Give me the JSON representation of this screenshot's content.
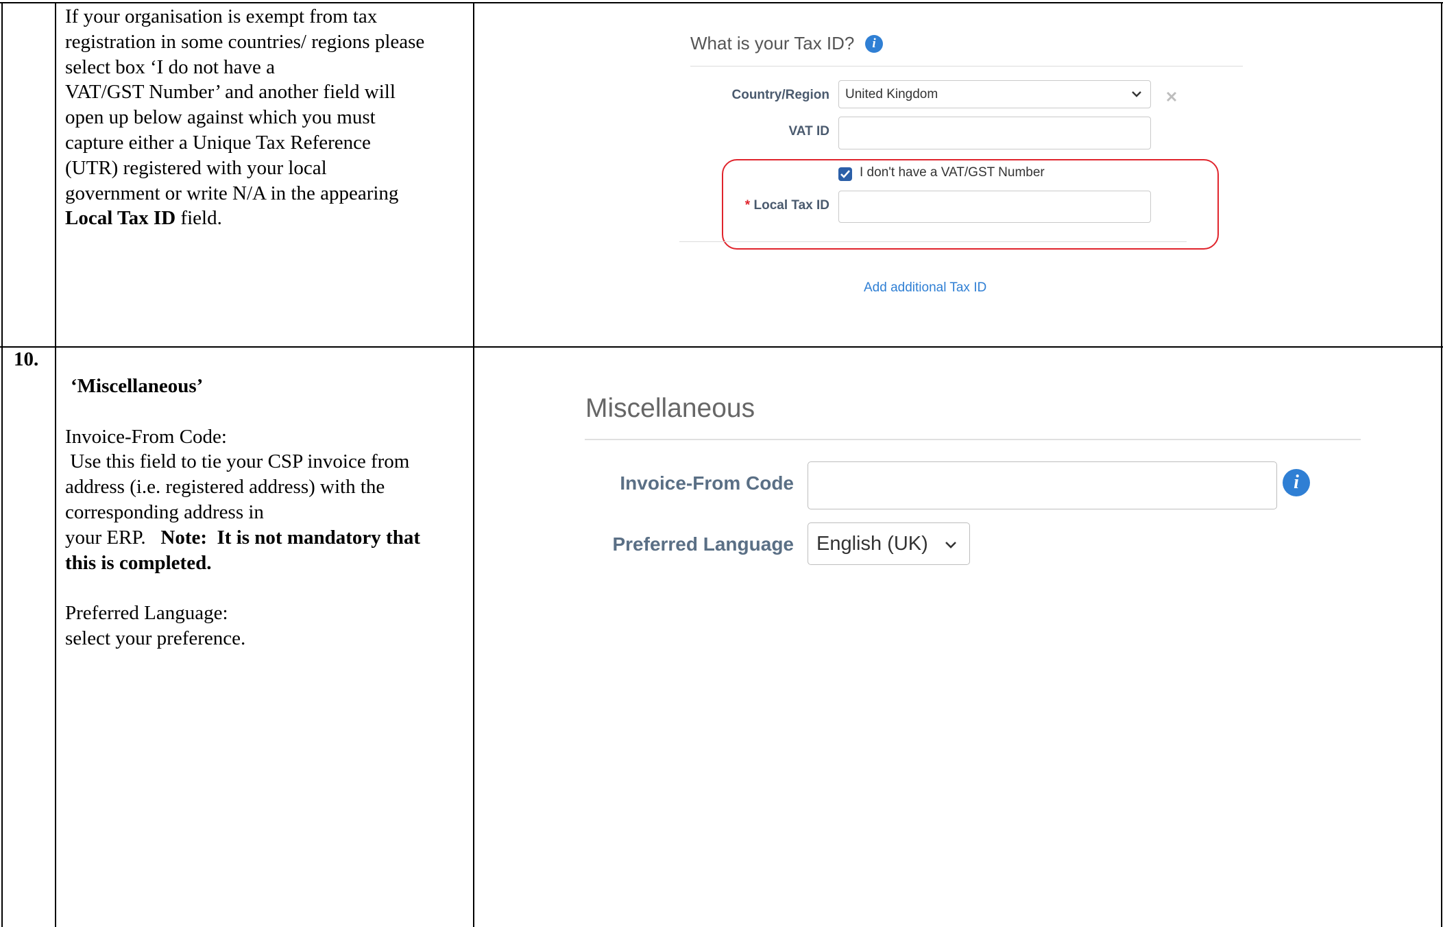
{
  "row_prev": {
    "description_lines": [
      "If your organisation is exempt from tax",
      "registration in some countries/ regions please",
      "select box ‘I do not have a",
      "VAT/GST Number’ and another field will",
      "open up below against which you must",
      "capture either a Unique Tax Reference",
      "(UTR) registered with your local",
      "government or write N/A in the appearing"
    ],
    "last_line_bold": "Local Tax ID",
    "last_line_rest": " field."
  },
  "tax_panel": {
    "title": "What is your Tax ID?",
    "country_label": "Country/Region",
    "country_value": "United Kingdom",
    "vat_label": "VAT ID",
    "vat_value": "",
    "checkbox_label": "I don't have a VAT/GST Number",
    "checkbox_checked": true,
    "required_mark": "*",
    "local_tax_label": "Local Tax ID",
    "local_tax_value": "",
    "add_link": "Add additional Tax ID",
    "highlight_color": "#e0242c",
    "accent_color": "#2f7fd4"
  },
  "row_10": {
    "number": "10.",
    "heading": "‘Miscellaneous’",
    "invoice_heading": "Invoice-From Code:",
    "invoice_lines": [
      " Use this field to tie your CSP invoice from",
      "address (i.e. registered address) with the",
      "corresponding address in"
    ],
    "erp_line_start": "your ERP.   ",
    "note_bold_1": "Note:  It is not mandatory that",
    "note_bold_2": "this is completed.",
    "language_heading": "Preferred Language:",
    "language_text": "select your preference."
  },
  "misc_panel": {
    "title": "Miscellaneous",
    "invoice_label": "Invoice-From Code",
    "invoice_value": "",
    "language_label": "Preferred Language",
    "language_value": "English (UK)"
  }
}
